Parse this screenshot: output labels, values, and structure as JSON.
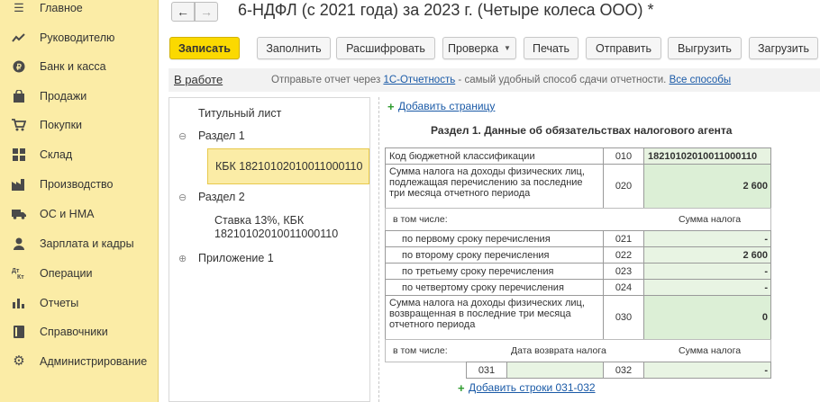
{
  "sidebar": {
    "items": [
      {
        "icon": "menu-icon",
        "label": "Главное"
      },
      {
        "icon": "chart-trend-icon",
        "label": "Руководителю"
      },
      {
        "icon": "coin-icon",
        "label": "Банк и касса"
      },
      {
        "icon": "shopping-bag-icon",
        "label": "Продажи"
      },
      {
        "icon": "cart-icon",
        "label": "Покупки"
      },
      {
        "icon": "warehouse-icon",
        "label": "Склад"
      },
      {
        "icon": "factory-icon",
        "label": "Производство"
      },
      {
        "icon": "truck-icon",
        "label": "ОС и НМА"
      },
      {
        "icon": "person-icon",
        "label": "Зарплата и кадры"
      },
      {
        "icon": "operations-icon",
        "label": "Операции"
      },
      {
        "icon": "bar-chart-icon",
        "label": "Отчеты"
      },
      {
        "icon": "book-icon",
        "label": "Справочники"
      },
      {
        "icon": "gear-icon",
        "label": "Администрирование"
      }
    ]
  },
  "header": {
    "back_glyph": "←",
    "forward_glyph": "→",
    "title": "6-НДФЛ (с 2021 года) за 2023 г. (Четыре колеса ООО) *"
  },
  "toolbar": {
    "save": "Записать",
    "fill": "Заполнить",
    "decode": "Расшифровать",
    "check": "Проверка",
    "print": "Печать",
    "send": "Отправить",
    "upload": "Выгрузить",
    "load": "Загрузить"
  },
  "infobar": {
    "status": "В работе",
    "hint_before": "Отправьте отчет через ",
    "hint_link": "1С-Отчетность",
    "hint_after": " - самый удобный способ сдачи отчетности. ",
    "hint_link2": "Все способы"
  },
  "tree": {
    "title_sheet": "Титульный лист",
    "section1": "Раздел 1",
    "kbk_item": "КБК 18210102010011000110",
    "section2": "Раздел 2",
    "rate_line1": "Ставка 13%, КБК",
    "rate_line2": "18210102010011000110",
    "appendix": "Приложение 1",
    "collapse_glyph": "⊖",
    "expand_glyph": "⊕"
  },
  "document": {
    "add_page": "Добавить страницу",
    "section_title": "Раздел 1. Данные об обязательствах налогового агента",
    "rows": {
      "kbk_label": "Код бюджетной классификации",
      "kbk_code": "010",
      "kbk_value": "18210102010011000110",
      "r020_label": "Сумма налога на доходы физических лиц, подлежащая перечислению за последние три месяца отчетного периода",
      "r020_code": "020",
      "r020_value": "2 600",
      "incl_label": "в том числе:",
      "incl_header": "Сумма налога",
      "r021_label": "по первому сроку перечисления",
      "r021_code": "021",
      "r021_value": "-",
      "r022_label": "по второму сроку перечисления",
      "r022_code": "022",
      "r022_value": "2 600",
      "r023_label": "по третьему сроку перечисления",
      "r023_code": "023",
      "r023_value": "-",
      "r024_label": "по четвертому сроку перечисления",
      "r024_code": "024",
      "r024_value": "-",
      "r030_label": "Сумма налога на доходы физических лиц, возвращенная в последние три месяца отчетного периода",
      "r030_code": "030",
      "r030_value": "0",
      "incl2_label": "в том числе:",
      "return_date_header": "Дата возврата налога",
      "return_sum_header": "Сумма налога",
      "r031_code": "031",
      "r032_code": "032",
      "r032_value": "-"
    },
    "add_rows": "Добавить строки 031-032"
  }
}
